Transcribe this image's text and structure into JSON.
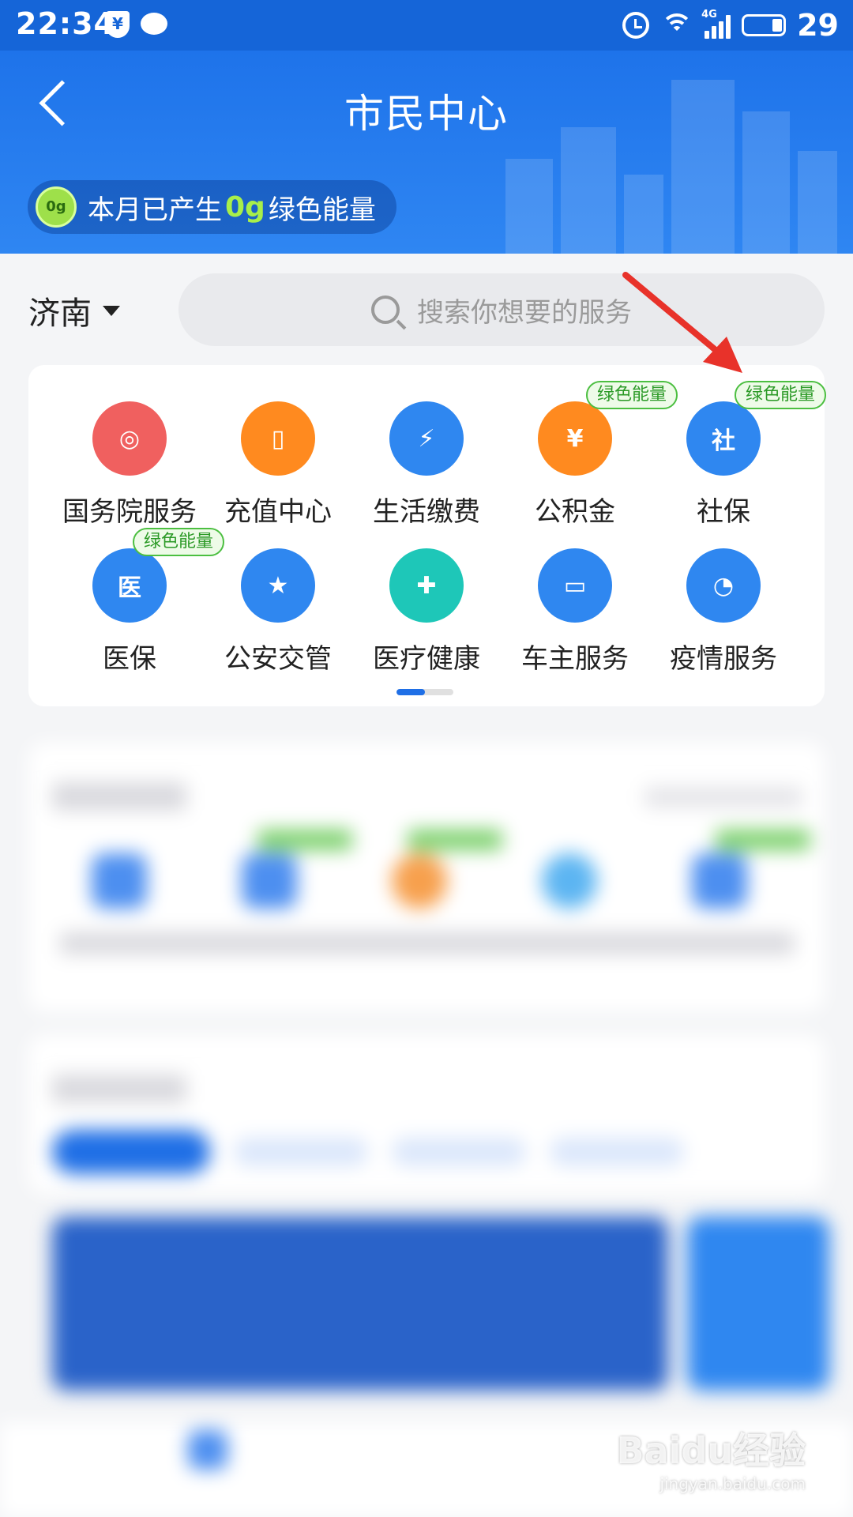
{
  "status_bar": {
    "time": "22:34",
    "shield_glyph": "¥",
    "network": "4G",
    "battery": "29"
  },
  "header": {
    "title": "市民中心",
    "energy_prefix": "本月已产生",
    "energy_value": "0g",
    "energy_suffix": "绿色能量",
    "badge": "0g"
  },
  "location": {
    "city": "济南"
  },
  "search": {
    "placeholder": "搜索你想要的服务"
  },
  "services": {
    "tag_label": "绿色能量",
    "items": [
      {
        "label": "国务院服务",
        "color": "#f0605f",
        "icon": "emblem-icon",
        "glyph": "◎"
      },
      {
        "label": "充值中心",
        "color": "#ff8a1f",
        "icon": "phone-icon",
        "glyph": "▯"
      },
      {
        "label": "生活缴费",
        "color": "#2f87f0",
        "icon": "water-drop-icon",
        "glyph": "⚡"
      },
      {
        "label": "公积金",
        "color": "#ff8a1f",
        "icon": "house-yuan-icon",
        "glyph": "¥"
      },
      {
        "label": "社保",
        "color": "#2f87f0",
        "icon": "shield-social-icon",
        "glyph": "社"
      },
      {
        "label": "医保",
        "color": "#2f87f0",
        "icon": "shield-medical-icon",
        "glyph": "医"
      },
      {
        "label": "公安交管",
        "color": "#2f87f0",
        "icon": "police-icon",
        "glyph": "★"
      },
      {
        "label": "医疗健康",
        "color": "#1ec7b8",
        "icon": "stethoscope-icon",
        "glyph": "✚"
      },
      {
        "label": "车主服务",
        "color": "#2f87f0",
        "icon": "car-icon",
        "glyph": "▭"
      },
      {
        "label": "疫情服务",
        "color": "#2f87f0",
        "icon": "clock-icon",
        "glyph": "◔"
      }
    ]
  },
  "watermark": {
    "main": "Baidu经验",
    "sub": "jingyan.baidu.com"
  },
  "colors": {
    "header_blue": "#1e73ea",
    "green_tag": "#2c9a27",
    "annotation_red": "#e8322a"
  }
}
